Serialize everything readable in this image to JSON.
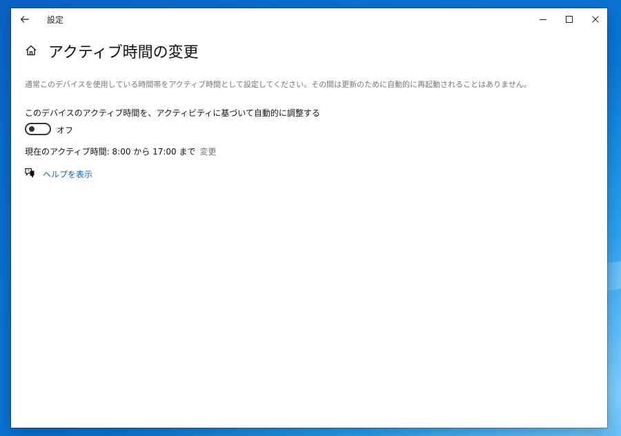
{
  "window": {
    "app_title": "設定"
  },
  "page": {
    "title": "アクティブ時間の変更",
    "description": "通常このデバイスを使用している時間帯をアクティブ時間として設定してください。その間は更新のために自動的に再起動されることはありません。"
  },
  "auto_adjust": {
    "label": "このデバイスのアクティブ時間を、アクティビティに基づいて自動的に調整する",
    "state": "オフ",
    "on": false
  },
  "current_hours": {
    "text": "現在のアクティブ時間: 8:00 から 17:00 まで",
    "change_label": "変更"
  },
  "help": {
    "label": "ヘルプを表示"
  },
  "colors": {
    "accent": "#0067c0",
    "secondary_text": "#767676"
  },
  "icons": [
    "back-arrow-icon",
    "minimize-icon",
    "maximize-icon",
    "close-icon",
    "home-icon",
    "help-chat-icon"
  ]
}
